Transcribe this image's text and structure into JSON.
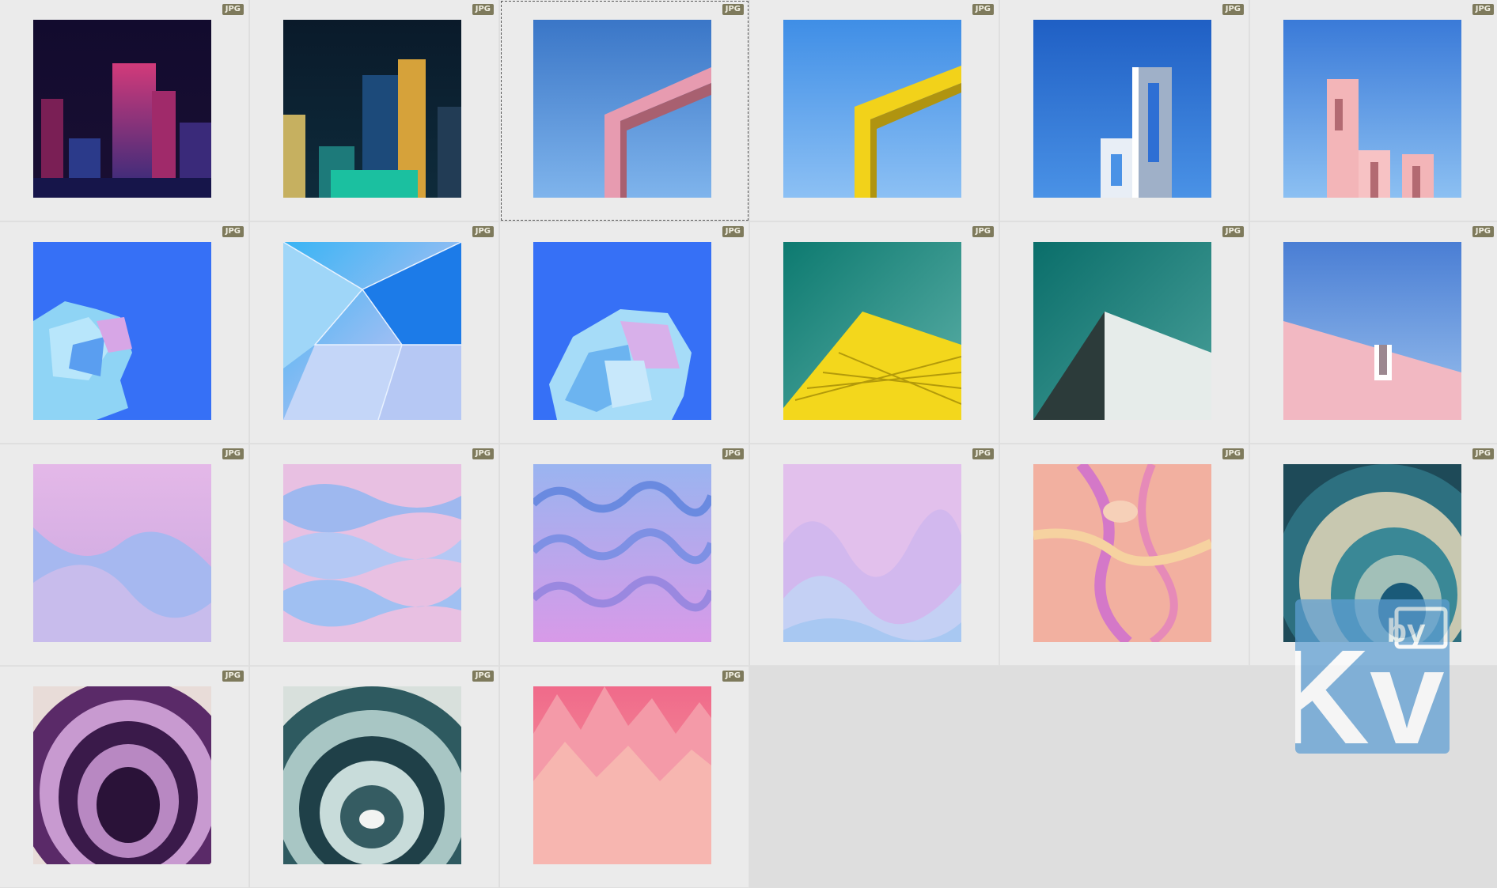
{
  "items": [
    {
      "type": "JPG",
      "art": "neon-city-pink"
    },
    {
      "type": "JPG",
      "art": "neon-city-gold"
    },
    {
      "type": "JPG",
      "art": "pink-frame-sky"
    },
    {
      "type": "JPG",
      "art": "yellow-frame-sky"
    },
    {
      "type": "JPG",
      "art": "white-towers-sky"
    },
    {
      "type": "JPG",
      "art": "pink-towers-sky"
    },
    {
      "type": "JPG",
      "art": "crystal-flower-left"
    },
    {
      "type": "JPG",
      "art": "blue-polygon-web"
    },
    {
      "type": "JPG",
      "art": "crystal-flower-bottom"
    },
    {
      "type": "JPG",
      "art": "yellow-building-teal"
    },
    {
      "type": "JPG",
      "art": "white-building-teal"
    },
    {
      "type": "JPG",
      "art": "pink-wall-sky"
    },
    {
      "type": "JPG",
      "art": "lavender-wave"
    },
    {
      "type": "JPG",
      "art": "pastel-ripples"
    },
    {
      "type": "JPG",
      "art": "purple-dunes"
    },
    {
      "type": "JPG",
      "art": "lilac-hills"
    },
    {
      "type": "JPG",
      "art": "orange-liquid"
    },
    {
      "type": "JPG",
      "art": "teal-agate"
    },
    {
      "type": "JPG",
      "art": "purple-agate"
    },
    {
      "type": "JPG",
      "art": "teal-agate-rings"
    },
    {
      "type": "JPG",
      "art": "coral-peaks"
    }
  ],
  "selected_index": 2,
  "watermark": {
    "text": "Kv",
    "small_text": "by"
  }
}
